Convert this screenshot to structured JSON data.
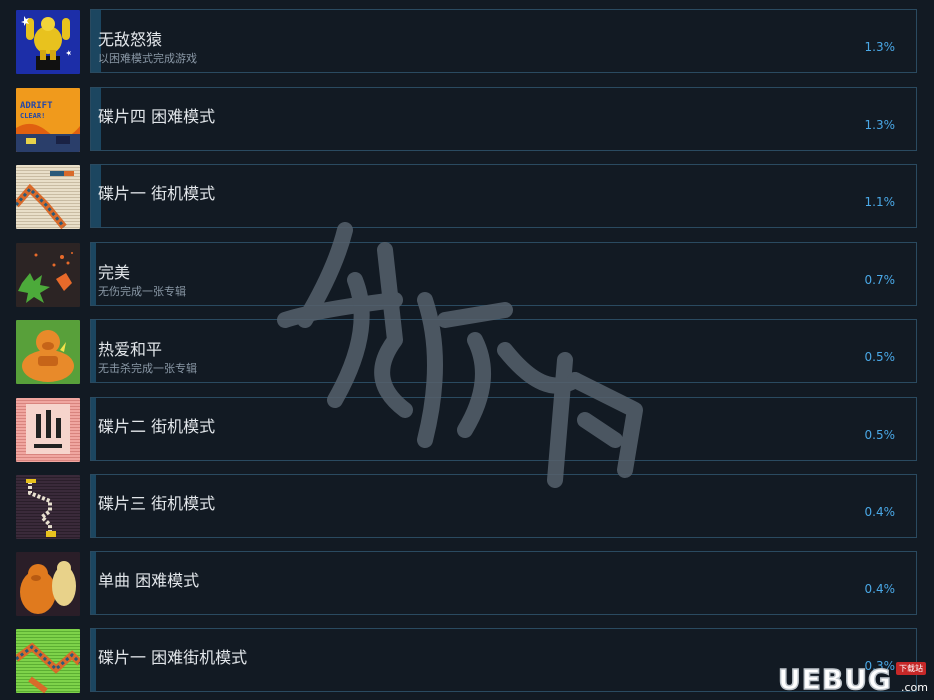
{
  "achievements": [
    {
      "title": "无敌怒猿",
      "desc": "以困难模式完成游戏",
      "percent": "1.3%",
      "icon": "golden-gorilla-statue-icon"
    },
    {
      "title": "碟片四 困难模式",
      "desc": "",
      "percent": "1.3%",
      "icon": "adrift-clear-icon"
    },
    {
      "title": "碟片一 街机模式",
      "desc": "",
      "percent": "1.1%",
      "icon": "pixel-track-icon"
    },
    {
      "title": "完美",
      "desc": "无伤完成一张专辑",
      "percent": "0.7%",
      "icon": "green-leaf-splatter-icon"
    },
    {
      "title": "热爱和平",
      "desc": "无击杀完成一张专辑",
      "percent": "0.5%",
      "icon": "gorilla-meditating-icon"
    },
    {
      "title": "碟片二 街机模式",
      "desc": "",
      "percent": "0.5%",
      "icon": "pixel-face-icon"
    },
    {
      "title": "碟片三 街机模式",
      "desc": "",
      "percent": "0.4%",
      "icon": "pixel-zigzag-icon"
    },
    {
      "title": "单曲 困难模式",
      "desc": "",
      "percent": "0.4%",
      "icon": "gorilla-duo-icon"
    },
    {
      "title": "碟片一 困难街机模式",
      "desc": "",
      "percent": "0.3%",
      "icon": "pixel-green-track-icon"
    }
  ],
  "watermark": {
    "text": "游侠网"
  },
  "logo": {
    "text": "UEBUG",
    "domain": ".com",
    "badge": "下载站"
  }
}
